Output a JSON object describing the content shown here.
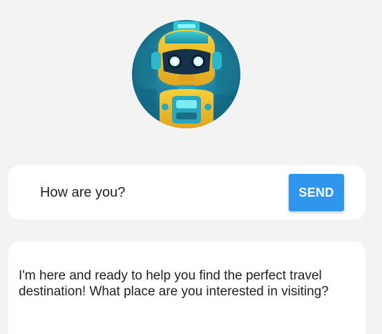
{
  "avatar": {
    "alt": "robot assistant avatar"
  },
  "chat_input": {
    "value": "How are you?"
  },
  "send_button": {
    "label": "SEND"
  },
  "reply": {
    "text": "I'm here and ready to help you find the perfect travel destination! What place are you interested in visiting?"
  },
  "colors": {
    "background": "#f3f3f4",
    "card": "#ffffff",
    "accent": "#2f96ee",
    "text": "#1f1f1f"
  }
}
